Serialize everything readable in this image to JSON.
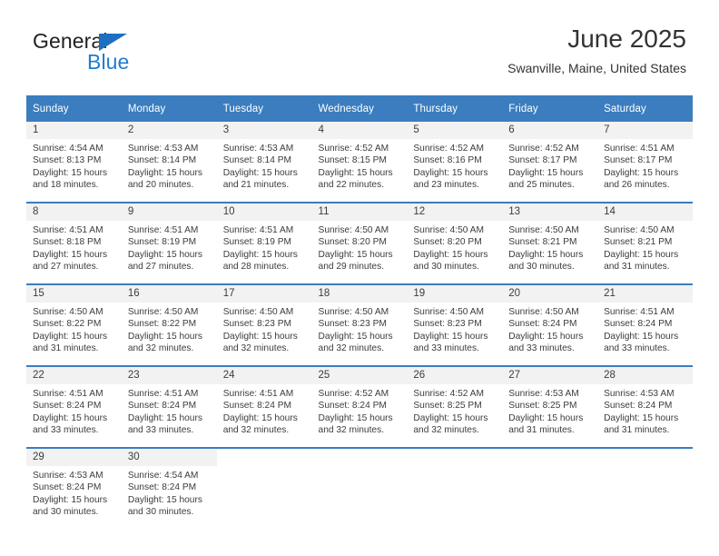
{
  "brand": {
    "word_one": "General",
    "word_two": "Blue",
    "triangle_icon": "blue-triangle-icon",
    "accent_color": "#1f7cd1"
  },
  "header": {
    "title": "June 2025",
    "subtitle": "Swanville, Maine, United States"
  },
  "theme": {
    "header_blue": "#3b7dbf",
    "daynum_band": "#f2f2f2",
    "text": "#3c3c3c"
  },
  "calendar": {
    "weekday_headers": [
      "Sunday",
      "Monday",
      "Tuesday",
      "Wednesday",
      "Thursday",
      "Friday",
      "Saturday"
    ],
    "labels": {
      "sunrise": "Sunrise:",
      "sunset": "Sunset:",
      "daylight": "Daylight:"
    },
    "weeks": [
      [
        {
          "day": "1",
          "sunrise": "Sunrise: 4:54 AM",
          "sunset": "Sunset: 8:13 PM",
          "daylight_1": "Daylight: 15 hours",
          "daylight_2": "and 18 minutes."
        },
        {
          "day": "2",
          "sunrise": "Sunrise: 4:53 AM",
          "sunset": "Sunset: 8:14 PM",
          "daylight_1": "Daylight: 15 hours",
          "daylight_2": "and 20 minutes."
        },
        {
          "day": "3",
          "sunrise": "Sunrise: 4:53 AM",
          "sunset": "Sunset: 8:14 PM",
          "daylight_1": "Daylight: 15 hours",
          "daylight_2": "and 21 minutes."
        },
        {
          "day": "4",
          "sunrise": "Sunrise: 4:52 AM",
          "sunset": "Sunset: 8:15 PM",
          "daylight_1": "Daylight: 15 hours",
          "daylight_2": "and 22 minutes."
        },
        {
          "day": "5",
          "sunrise": "Sunrise: 4:52 AM",
          "sunset": "Sunset: 8:16 PM",
          "daylight_1": "Daylight: 15 hours",
          "daylight_2": "and 23 minutes."
        },
        {
          "day": "6",
          "sunrise": "Sunrise: 4:52 AM",
          "sunset": "Sunset: 8:17 PM",
          "daylight_1": "Daylight: 15 hours",
          "daylight_2": "and 25 minutes."
        },
        {
          "day": "7",
          "sunrise": "Sunrise: 4:51 AM",
          "sunset": "Sunset: 8:17 PM",
          "daylight_1": "Daylight: 15 hours",
          "daylight_2": "and 26 minutes."
        }
      ],
      [
        {
          "day": "8",
          "sunrise": "Sunrise: 4:51 AM",
          "sunset": "Sunset: 8:18 PM",
          "daylight_1": "Daylight: 15 hours",
          "daylight_2": "and 27 minutes."
        },
        {
          "day": "9",
          "sunrise": "Sunrise: 4:51 AM",
          "sunset": "Sunset: 8:19 PM",
          "daylight_1": "Daylight: 15 hours",
          "daylight_2": "and 27 minutes."
        },
        {
          "day": "10",
          "sunrise": "Sunrise: 4:51 AM",
          "sunset": "Sunset: 8:19 PM",
          "daylight_1": "Daylight: 15 hours",
          "daylight_2": "and 28 minutes."
        },
        {
          "day": "11",
          "sunrise": "Sunrise: 4:50 AM",
          "sunset": "Sunset: 8:20 PM",
          "daylight_1": "Daylight: 15 hours",
          "daylight_2": "and 29 minutes."
        },
        {
          "day": "12",
          "sunrise": "Sunrise: 4:50 AM",
          "sunset": "Sunset: 8:20 PM",
          "daylight_1": "Daylight: 15 hours",
          "daylight_2": "and 30 minutes."
        },
        {
          "day": "13",
          "sunrise": "Sunrise: 4:50 AM",
          "sunset": "Sunset: 8:21 PM",
          "daylight_1": "Daylight: 15 hours",
          "daylight_2": "and 30 minutes."
        },
        {
          "day": "14",
          "sunrise": "Sunrise: 4:50 AM",
          "sunset": "Sunset: 8:21 PM",
          "daylight_1": "Daylight: 15 hours",
          "daylight_2": "and 31 minutes."
        }
      ],
      [
        {
          "day": "15",
          "sunrise": "Sunrise: 4:50 AM",
          "sunset": "Sunset: 8:22 PM",
          "daylight_1": "Daylight: 15 hours",
          "daylight_2": "and 31 minutes."
        },
        {
          "day": "16",
          "sunrise": "Sunrise: 4:50 AM",
          "sunset": "Sunset: 8:22 PM",
          "daylight_1": "Daylight: 15 hours",
          "daylight_2": "and 32 minutes."
        },
        {
          "day": "17",
          "sunrise": "Sunrise: 4:50 AM",
          "sunset": "Sunset: 8:23 PM",
          "daylight_1": "Daylight: 15 hours",
          "daylight_2": "and 32 minutes."
        },
        {
          "day": "18",
          "sunrise": "Sunrise: 4:50 AM",
          "sunset": "Sunset: 8:23 PM",
          "daylight_1": "Daylight: 15 hours",
          "daylight_2": "and 32 minutes."
        },
        {
          "day": "19",
          "sunrise": "Sunrise: 4:50 AM",
          "sunset": "Sunset: 8:23 PM",
          "daylight_1": "Daylight: 15 hours",
          "daylight_2": "and 33 minutes."
        },
        {
          "day": "20",
          "sunrise": "Sunrise: 4:50 AM",
          "sunset": "Sunset: 8:24 PM",
          "daylight_1": "Daylight: 15 hours",
          "daylight_2": "and 33 minutes."
        },
        {
          "day": "21",
          "sunrise": "Sunrise: 4:51 AM",
          "sunset": "Sunset: 8:24 PM",
          "daylight_1": "Daylight: 15 hours",
          "daylight_2": "and 33 minutes."
        }
      ],
      [
        {
          "day": "22",
          "sunrise": "Sunrise: 4:51 AM",
          "sunset": "Sunset: 8:24 PM",
          "daylight_1": "Daylight: 15 hours",
          "daylight_2": "and 33 minutes."
        },
        {
          "day": "23",
          "sunrise": "Sunrise: 4:51 AM",
          "sunset": "Sunset: 8:24 PM",
          "daylight_1": "Daylight: 15 hours",
          "daylight_2": "and 33 minutes."
        },
        {
          "day": "24",
          "sunrise": "Sunrise: 4:51 AM",
          "sunset": "Sunset: 8:24 PM",
          "daylight_1": "Daylight: 15 hours",
          "daylight_2": "and 32 minutes."
        },
        {
          "day": "25",
          "sunrise": "Sunrise: 4:52 AM",
          "sunset": "Sunset: 8:24 PM",
          "daylight_1": "Daylight: 15 hours",
          "daylight_2": "and 32 minutes."
        },
        {
          "day": "26",
          "sunrise": "Sunrise: 4:52 AM",
          "sunset": "Sunset: 8:25 PM",
          "daylight_1": "Daylight: 15 hours",
          "daylight_2": "and 32 minutes."
        },
        {
          "day": "27",
          "sunrise": "Sunrise: 4:53 AM",
          "sunset": "Sunset: 8:25 PM",
          "daylight_1": "Daylight: 15 hours",
          "daylight_2": "and 31 minutes."
        },
        {
          "day": "28",
          "sunrise": "Sunrise: 4:53 AM",
          "sunset": "Sunset: 8:24 PM",
          "daylight_1": "Daylight: 15 hours",
          "daylight_2": "and 31 minutes."
        }
      ],
      [
        {
          "day": "29",
          "sunrise": "Sunrise: 4:53 AM",
          "sunset": "Sunset: 8:24 PM",
          "daylight_1": "Daylight: 15 hours",
          "daylight_2": "and 30 minutes."
        },
        {
          "day": "30",
          "sunrise": "Sunrise: 4:54 AM",
          "sunset": "Sunset: 8:24 PM",
          "daylight_1": "Daylight: 15 hours",
          "daylight_2": "and 30 minutes."
        },
        {
          "day": "",
          "sunrise": "",
          "sunset": "",
          "daylight_1": "",
          "daylight_2": ""
        },
        {
          "day": "",
          "sunrise": "",
          "sunset": "",
          "daylight_1": "",
          "daylight_2": ""
        },
        {
          "day": "",
          "sunrise": "",
          "sunset": "",
          "daylight_1": "",
          "daylight_2": ""
        },
        {
          "day": "",
          "sunrise": "",
          "sunset": "",
          "daylight_1": "",
          "daylight_2": ""
        },
        {
          "day": "",
          "sunrise": "",
          "sunset": "",
          "daylight_1": "",
          "daylight_2": ""
        }
      ]
    ]
  }
}
